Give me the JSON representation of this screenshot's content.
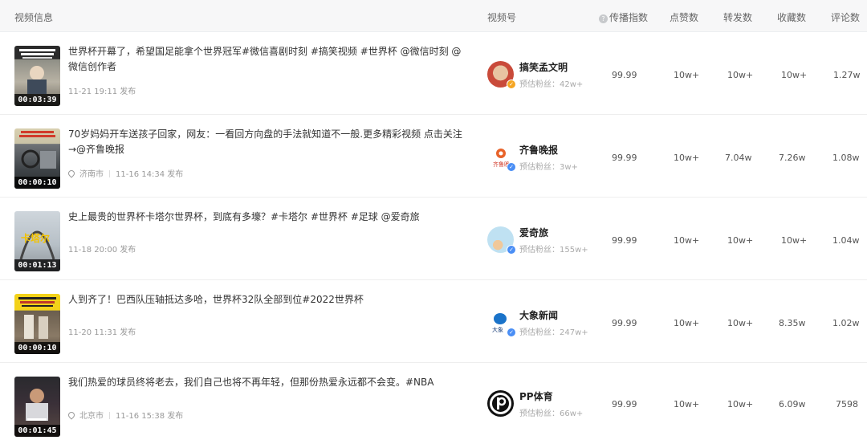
{
  "header": {
    "video_info": "视频信息",
    "channel": "视频号",
    "spread_index": "传播指数",
    "likes": "点赞数",
    "shares": "转发数",
    "favorites": "收藏数",
    "comments": "评论数"
  },
  "rows": [
    {
      "duration": "00:03:39",
      "title": "世界杯开幕了，希望国足能拿个世界冠军#微信喜剧时刻 #搞笑视频 #世界杯 @微信时刻 @微信创作者",
      "location": "",
      "published": "11-21 19:11 发布",
      "account": "搞笑孟文明",
      "fans": "预估粉丝：42w+",
      "verified_color": "#f5a623",
      "spread_index": "99.99",
      "likes": "10w+",
      "shares": "10w+",
      "favorites": "10w+",
      "comments": "1.27w"
    },
    {
      "duration": "00:00:10",
      "title": "70岁妈妈开车送孩子回家，网友：一看回方向盘的手法就知道不一般.更多精彩视频 点击关注→@齐鲁晚报",
      "location": "济南市",
      "published": "11-16 14:34 发布",
      "account": "齐鲁晚报",
      "fans": "预估粉丝：3w+",
      "verified_color": "#4a8ef5",
      "spread_index": "99.99",
      "likes": "10w+",
      "shares": "7.04w",
      "favorites": "7.26w",
      "comments": "1.08w"
    },
    {
      "duration": "00:01:13",
      "title": "史上最贵的世界杯卡塔尔世界杯，到底有多壕？#卡塔尔 #世界杯 #足球 @爱奇旅",
      "location": "",
      "published": "11-18 20:00 发布",
      "account": "爱奇旅",
      "fans": "预估粉丝：155w+",
      "verified_color": "#4a8ef5",
      "spread_index": "99.99",
      "likes": "10w+",
      "shares": "10w+",
      "favorites": "10w+",
      "comments": "1.04w"
    },
    {
      "duration": "00:00:10",
      "title": "人到齐了！巴西队压轴抵达多哈，世界杯32队全部到位#2022世界杯",
      "location": "",
      "published": "11-20 11:31 发布",
      "account": "大象新闻",
      "fans": "预估粉丝：247w+",
      "verified_color": "#4a8ef5",
      "spread_index": "99.99",
      "likes": "10w+",
      "shares": "10w+",
      "favorites": "8.35w",
      "comments": "1.02w"
    },
    {
      "duration": "00:01:45",
      "title": "我们热爱的球员终将老去，我们自己也将不再年轻，但那份热爱永远都不会变。#NBA",
      "location": "北京市",
      "published": "11-16 15:38 发布",
      "account": "PP体育",
      "fans": "预估粉丝：66w+",
      "verified_color": "#4a8ef5",
      "spread_index": "99.99",
      "likes": "10w+",
      "shares": "10w+",
      "favorites": "6.09w",
      "comments": "7598"
    }
  ]
}
